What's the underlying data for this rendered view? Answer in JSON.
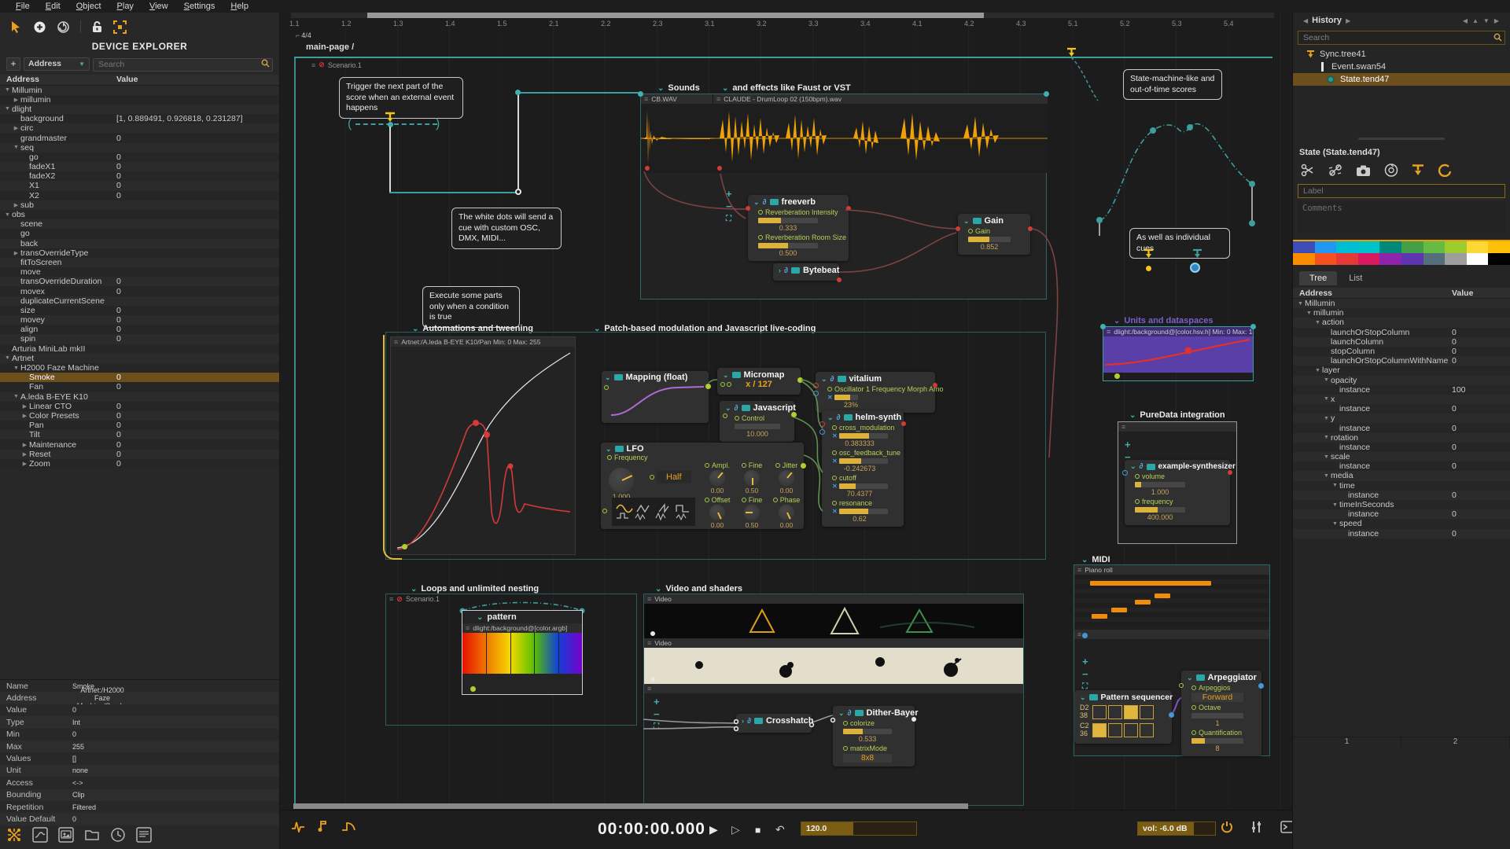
{
  "menu": {
    "items": [
      {
        "label": "File"
      },
      {
        "label": "Edit"
      },
      {
        "label": "Object"
      },
      {
        "label": "Play"
      },
      {
        "label": "View"
      },
      {
        "label": "Settings"
      },
      {
        "label": "Help"
      }
    ]
  },
  "left_panel": {
    "title": "DEVICE EXPLORER",
    "add_button": "+",
    "filter_label": "Address",
    "search_placeholder": "Search",
    "columns": {
      "address": "Address",
      "value": "Value"
    },
    "tree": [
      {
        "label": "Millumin",
        "indent": 0,
        "arrow": "down"
      },
      {
        "label": "millumin",
        "indent": 1,
        "arrow": "right"
      },
      {
        "label": "dlight",
        "indent": 0,
        "arrow": "down"
      },
      {
        "label": "background",
        "value": "[1, 0.889491, 0.926818, 0.231287]",
        "indent": 1,
        "arrow": "none"
      },
      {
        "label": "circ",
        "indent": 1,
        "arrow": "right"
      },
      {
        "label": "grandmaster",
        "value": "0",
        "indent": 1,
        "arrow": "none"
      },
      {
        "label": "seq",
        "indent": 1,
        "arrow": "down"
      },
      {
        "label": "go",
        "value": "0",
        "indent": 2,
        "arrow": "none"
      },
      {
        "label": "fadeX1",
        "value": "0",
        "indent": 2,
        "arrow": "none"
      },
      {
        "label": "fadeX2",
        "value": "0",
        "indent": 2,
        "arrow": "none"
      },
      {
        "label": "X1",
        "value": "0",
        "indent": 2,
        "arrow": "none"
      },
      {
        "label": "X2",
        "value": "0",
        "indent": 2,
        "arrow": "none"
      },
      {
        "label": "sub",
        "indent": 1,
        "arrow": "right"
      },
      {
        "label": "obs",
        "indent": 0,
        "arrow": "down"
      },
      {
        "label": "scene",
        "indent": 1,
        "arrow": "none"
      },
      {
        "label": "go",
        "indent": 1,
        "arrow": "none"
      },
      {
        "label": "back",
        "indent": 1,
        "arrow": "none"
      },
      {
        "label": "transOverrideType",
        "indent": 1,
        "arrow": "right"
      },
      {
        "label": "fitToScreen",
        "indent": 1,
        "arrow": "none"
      },
      {
        "label": "move",
        "indent": 1,
        "arrow": "none"
      },
      {
        "label": "transOverrideDuration",
        "value": "0",
        "indent": 1,
        "arrow": "none"
      },
      {
        "label": "movex",
        "value": "0",
        "indent": 1,
        "arrow": "none"
      },
      {
        "label": "duplicateCurrentScene",
        "indent": 1,
        "arrow": "none"
      },
      {
        "label": "size",
        "value": "0",
        "indent": 1,
        "arrow": "none"
      },
      {
        "label": "movey",
        "value": "0",
        "indent": 1,
        "arrow": "none"
      },
      {
        "label": "align",
        "value": "0",
        "indent": 1,
        "arrow": "none"
      },
      {
        "label": "spin",
        "value": "0",
        "indent": 1,
        "arrow": "none"
      },
      {
        "label": "Arturia MiniLab mkII",
        "indent": 0,
        "arrow": "none"
      },
      {
        "label": "Artnet",
        "indent": 0,
        "arrow": "down"
      },
      {
        "label": "H2000 Faze Machine",
        "indent": 1,
        "arrow": "down"
      },
      {
        "label": "Smoke",
        "value": "0",
        "indent": 2,
        "arrow": "none",
        "selected": true
      },
      {
        "label": "Fan",
        "value": "0",
        "indent": 2,
        "arrow": "none"
      },
      {
        "label": "A.leda B-EYE K10",
        "indent": 1,
        "arrow": "down"
      },
      {
        "label": "Linear CTO",
        "value": "0",
        "indent": 2,
        "arrow": "right"
      },
      {
        "label": "Color Presets",
        "value": "0",
        "indent": 2,
        "arrow": "right"
      },
      {
        "label": "Pan",
        "value": "0",
        "indent": 2,
        "arrow": "none"
      },
      {
        "label": "Tilt",
        "value": "0",
        "indent": 2,
        "arrow": "none"
      },
      {
        "label": "Maintenance",
        "value": "0",
        "indent": 2,
        "arrow": "right"
      },
      {
        "label": "Reset",
        "value": "0",
        "indent": 2,
        "arrow": "right"
      },
      {
        "label": "Zoom",
        "value": "0",
        "indent": 2,
        "arrow": "right"
      }
    ],
    "properties": [
      {
        "label": "Name",
        "value": "Smoke"
      },
      {
        "label": "Address",
        "value": "Artnet:/H2000 Faze Machine/Smoke"
      },
      {
        "label": "Value",
        "value": "0"
      },
      {
        "label": "Type",
        "value": "Int"
      },
      {
        "label": "Min",
        "value": "0"
      },
      {
        "label": "Max",
        "value": "255"
      },
      {
        "label": "Values",
        "value": "[]"
      },
      {
        "label": "Unit",
        "value": "none"
      },
      {
        "label": "Access",
        "value": "<->"
      },
      {
        "label": "Bounding",
        "value": "Clip"
      },
      {
        "label": "Repetition",
        "value": "Filtered",
        "checkbox": true
      },
      {
        "label": "Value Default",
        "value": "0"
      }
    ]
  },
  "canvas": {
    "ruler": [
      {
        "label": "1.1"
      },
      {
        "label": "1.2"
      },
      {
        "label": "1.3"
      },
      {
        "label": "1.4"
      },
      {
        "label": "1.5"
      },
      {
        "label": "2.1"
      },
      {
        "label": "2.2"
      },
      {
        "label": "2.3"
      },
      {
        "label": "3.1"
      },
      {
        "label": "3.2"
      },
      {
        "label": "3.3"
      },
      {
        "label": "3.4"
      },
      {
        "label": "4.1"
      },
      {
        "label": "4.2"
      },
      {
        "label": "4.3"
      },
      {
        "label": "5.1"
      },
      {
        "label": "5.2"
      },
      {
        "label": "5.3"
      },
      {
        "label": "5.4"
      }
    ],
    "time_signature": "4/4",
    "breadcrumb": "main-page /",
    "scenario_top": "Scenario.1",
    "scenario_loops": "Scenario.1",
    "notes": {
      "trigger": "Trigger the next part of the score when an external event happens",
      "white_dots": "The white dots will send a cue with custom OSC, DMX, MIDI...",
      "condition": "Execute some parts only when a condition is true",
      "state_machine": "State-machine-like and out-of-time scores",
      "cues": "As well as individual cues"
    },
    "sections": {
      "sounds": "Sounds",
      "effects": "and effects like Faust or VST",
      "automations": "Automations and tweening",
      "patch": "Patch-based modulation and Javascript live-coding",
      "loops": "Loops and unlimited nesting",
      "video": "Video and shaders",
      "units": "Units and dataspaces",
      "puredata": "PureData integration",
      "midi": "MIDI"
    },
    "sound_files": {
      "cb": "CB.WAV",
      "claude": "CLAUDE - DrumLoop 02 (150bpm).wav"
    },
    "automation_header": "Artnet:/A.leda B-EYE K10/Pan   Min: 0  Max: 255",
    "units_header": "dlight:/background@[color.hsv.h]  Min: 0  Max: 1",
    "pattern_header": "dlight:/background@[color.argb]",
    "video_label_1": "Video",
    "video_label_2": "Video",
    "piano_roll_label": "Piano roll",
    "piano_notes": [
      {
        "style": {
          "left": "8%",
          "top": "12%",
          "width": "62%"
        }
      },
      {
        "style": {
          "left": "41%",
          "top": "36%",
          "width": "8%"
        }
      },
      {
        "style": {
          "left": "31%",
          "top": "48%",
          "width": "8%"
        }
      },
      {
        "style": {
          "left": "19%",
          "top": "64%",
          "width": "8%"
        }
      },
      {
        "style": {
          "left": "9%",
          "top": "76%",
          "width": "8%"
        }
      }
    ],
    "nodes": {
      "freeverb": {
        "title": "freeverb",
        "params": [
          {
            "label": "Reverberation Intensity",
            "value": "0.333",
            "fill": "38%"
          },
          {
            "label": "Reverberation Room Size",
            "value": "0.500",
            "fill": "50%"
          }
        ]
      },
      "gain": {
        "title": "Gain",
        "param": "Gain",
        "value": "0.852",
        "fill": "50%"
      },
      "bytebeat": {
        "title": "Bytebeat"
      },
      "mapping": {
        "title": "Mapping (float)"
      },
      "micromap": {
        "title": "Micromap",
        "expr": "x / 127"
      },
      "javascript": {
        "title": "Javascript",
        "param": "Control",
        "value": "10.000"
      },
      "vitalium": {
        "title": "vitalium",
        "param": "Oscillator 1 Frequency Morph Amo",
        "value": "23%",
        "fill": "20%"
      },
      "helm": {
        "title": "helm-synth",
        "params": [
          {
            "label": "cross_modulation",
            "value": "0.383333",
            "fill": "62%"
          },
          {
            "label": "osc_feedback_tune",
            "value": "-0.242673",
            "fill": "45%"
          },
          {
            "label": "cutoff",
            "value": "70.4377",
            "fill": "35%"
          },
          {
            "label": "resonance",
            "value": "0.62",
            "fill": "60%"
          }
        ]
      },
      "lfo": {
        "title": "LFO",
        "freq_label": "Frequency",
        "freq_value": "1.000",
        "wave_label": "Half",
        "cells": [
          {
            "label": "Ampl.",
            "value": "0.00",
            "needle": "-140deg"
          },
          {
            "label": "Fine",
            "value": "0.50",
            "needle": "0deg"
          },
          {
            "label": "Jitter",
            "value": "0.00",
            "needle": "-140deg"
          },
          {
            "label": "Offset",
            "value": "0.00",
            "needle": "-25deg"
          },
          {
            "label": "Fine",
            "value": "0.50",
            "needle": "90deg"
          },
          {
            "label": "Phase",
            "value": "0.00",
            "needle": "-25deg"
          }
        ]
      },
      "pattern": {
        "title": "pattern"
      },
      "crosshatch": {
        "title": "Crosshatch"
      },
      "dither": {
        "title": "Dither-Bayer",
        "params": [
          {
            "label": "colorize",
            "value": "0.533",
            "fill": "40%"
          },
          {
            "label": "matrixMode",
            "value": "8x8"
          }
        ]
      },
      "synth": {
        "title": "example-synthesizer",
        "params": [
          {
            "label": "volume",
            "value": "1.000",
            "fill": "12%"
          },
          {
            "label": "frequency",
            "value": "400.000",
            "fill": "45%"
          }
        ]
      },
      "pattern_seq": {
        "title": "Pattern sequencer",
        "row1_note": "D2",
        "row1_num": "38",
        "row1_cells": [
          {
            "on": false
          },
          {
            "on": false
          },
          {
            "on": true
          },
          {
            "on": false
          }
        ],
        "row2_note": "C2",
        "row2_num": "36",
        "row2_cells": [
          {
            "on": true
          },
          {
            "on": false
          },
          {
            "on": false
          },
          {
            "on": false
          }
        ]
      },
      "arpeggiator": {
        "title": "Arpeggiator",
        "p1_label": "Arpeggios",
        "p1_value": "Forward",
        "p2_label": "Octave",
        "p2_value": "1",
        "p3_label": "Quantification",
        "p3_value": "8",
        "p3_fill": "25%"
      }
    }
  },
  "right_panel": {
    "history_title": "History",
    "search_placeholder": "Search",
    "history_tree": [
      {
        "label": "Sync.tree41",
        "icon": "sync",
        "arrow": "down"
      },
      {
        "label": "Event.swan54",
        "icon": "event",
        "arrow": "down",
        "indent": 1
      },
      {
        "label": "State.tend47",
        "icon": "state",
        "arrow": "none",
        "indent": 2,
        "selected": true
      }
    ],
    "inspector_title": "State (State.tend47)",
    "label_placeholder": "Label",
    "comments_placeholder": "Comments",
    "palette": [
      {
        "color": "#3d4db7"
      },
      {
        "color": "#2196f3"
      },
      {
        "color": "#00bcd4"
      },
      {
        "color": "#00c2cb"
      },
      {
        "color": "#00897b"
      },
      {
        "color": "#43a047"
      },
      {
        "color": "#66bb44"
      },
      {
        "color": "#9ccc2e"
      },
      {
        "color": "#fdd835"
      },
      {
        "color": "#ffc107"
      },
      {
        "color": "#fb8c00"
      },
      {
        "color": "#f4511e"
      },
      {
        "color": "#e53935"
      },
      {
        "color": "#d81b60"
      },
      {
        "color": "#8e24aa"
      },
      {
        "color": "#5e35b1"
      },
      {
        "color": "#546e7a"
      },
      {
        "color": "#9e9e9e"
      },
      {
        "color": "#ffffff"
      },
      {
        "color": "#000000"
      }
    ],
    "tabs": {
      "tree": "Tree",
      "list": "List"
    },
    "columns": {
      "address": "Address",
      "value": "Value"
    },
    "tree": [
      {
        "label": "Millumin",
        "indent": 0,
        "arrow": "down"
      },
      {
        "label": "millumin",
        "indent": 1,
        "arrow": "down"
      },
      {
        "label": "action",
        "indent": 2,
        "arrow": "down"
      },
      {
        "label": "launchOrStopColumn",
        "value": "0",
        "indent": 3,
        "arrow": "none"
      },
      {
        "label": "launchColumn",
        "value": "0",
        "indent": 3,
        "arrow": "none"
      },
      {
        "label": "stopColumn",
        "value": "0",
        "indent": 3,
        "arrow": "none"
      },
      {
        "label": "launchOrStopColumnWithName",
        "value": "0",
        "indent": 3,
        "arrow": "none"
      },
      {
        "label": "layer",
        "indent": 2,
        "arrow": "down"
      },
      {
        "label": "opacity",
        "indent": 3,
        "arrow": "down"
      },
      {
        "label": "instance",
        "value": "100",
        "indent": 4,
        "arrow": "none"
      },
      {
        "label": "x",
        "indent": 3,
        "arrow": "down"
      },
      {
        "label": "instance",
        "value": "0",
        "indent": 4,
        "arrow": "none"
      },
      {
        "label": "y",
        "indent": 3,
        "arrow": "down"
      },
      {
        "label": "instance",
        "value": "0",
        "indent": 4,
        "arrow": "none"
      },
      {
        "label": "rotation",
        "indent": 3,
        "arrow": "down"
      },
      {
        "label": "instance",
        "value": "0",
        "indent": 4,
        "arrow": "none"
      },
      {
        "label": "scale",
        "indent": 3,
        "arrow": "down"
      },
      {
        "label": "instance",
        "value": "0",
        "indent": 4,
        "arrow": "none"
      },
      {
        "label": "media",
        "indent": 3,
        "arrow": "down"
      },
      {
        "label": "time",
        "indent": 4,
        "arrow": "down"
      },
      {
        "label": "instance",
        "value": "0",
        "indent": 5,
        "arrow": "none"
      },
      {
        "label": "timeInSeconds",
        "indent": 4,
        "arrow": "down"
      },
      {
        "label": "instance",
        "value": "0",
        "indent": 5,
        "arrow": "none"
      },
      {
        "label": "speed",
        "indent": 4,
        "arrow": "down"
      },
      {
        "label": "instance",
        "value": "0",
        "indent": 5,
        "arrow": "none"
      }
    ],
    "pages": [
      {
        "label": "1"
      },
      {
        "label": "2"
      }
    ]
  },
  "transport": {
    "time": "00:00:00.000",
    "tempo": "120.0",
    "volume": "vol: -6.0 dB"
  }
}
